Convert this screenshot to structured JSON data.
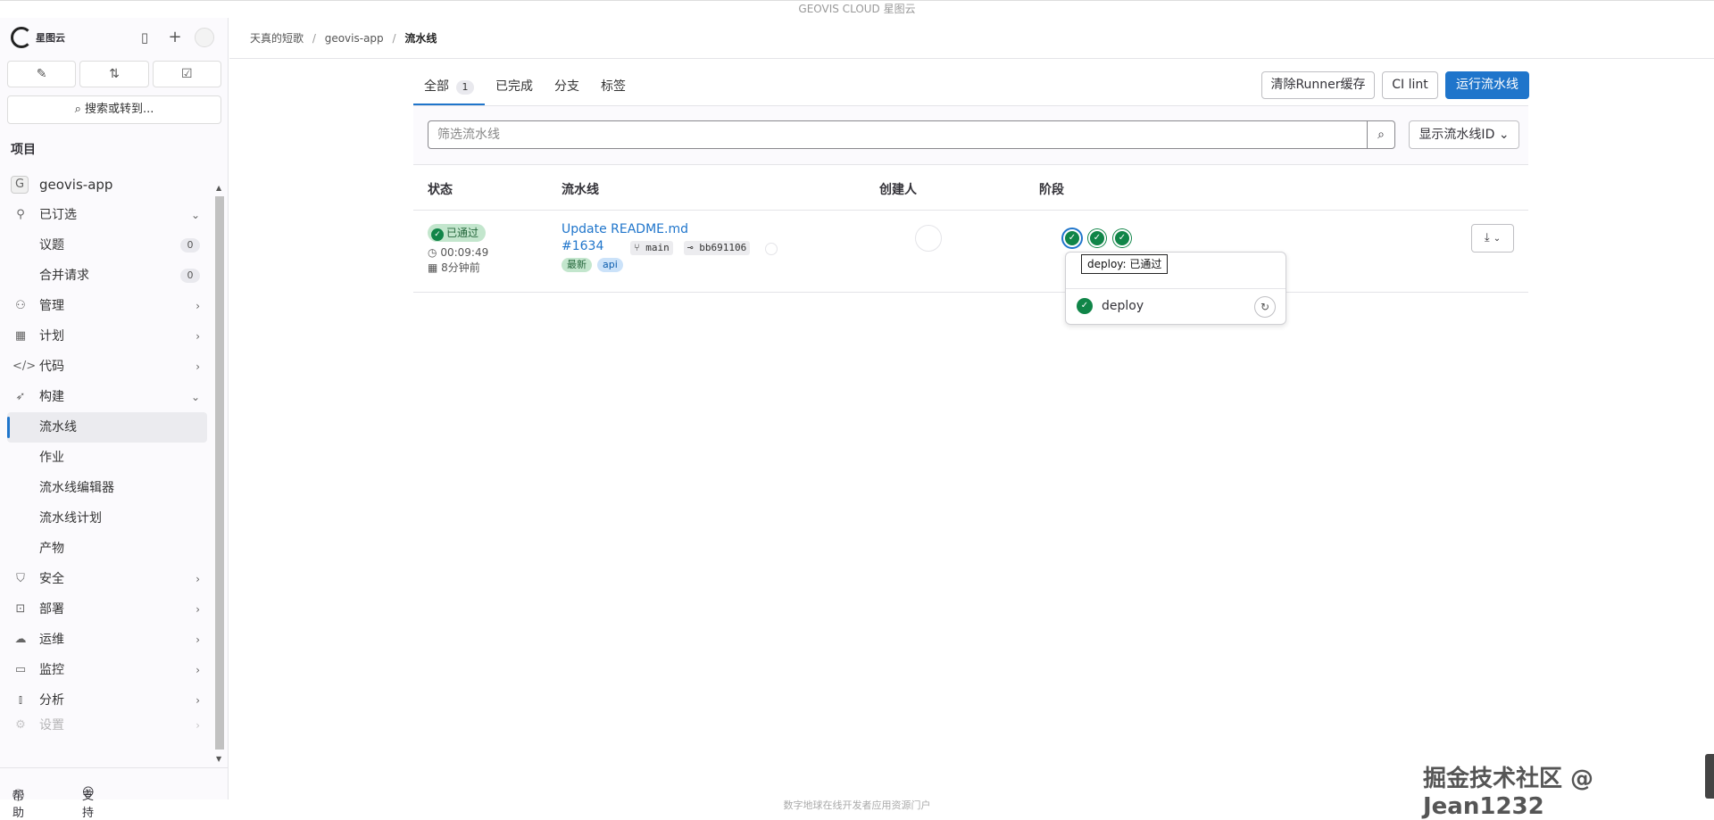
{
  "header": {
    "title": "GEOVIS CLOUD 星图云"
  },
  "sidebar": {
    "logo_text": "星图云",
    "search_label": "搜索或转到...",
    "section_title": "项目",
    "project": {
      "initial": "G",
      "name": "geovis-app"
    },
    "items": [
      {
        "label": "已订选",
        "icon": "pin-icon",
        "chevron": "⌄"
      },
      {
        "label": "议题",
        "count": "0",
        "sub": true
      },
      {
        "label": "合并请求",
        "count": "0",
        "sub": true
      },
      {
        "label": "管理",
        "icon": "users-icon",
        "chevron": "›"
      },
      {
        "label": "计划",
        "icon": "calendar-icon",
        "chevron": "›"
      },
      {
        "label": "代码",
        "icon": "code-icon",
        "chevron": "›"
      },
      {
        "label": "构建",
        "icon": "rocket-icon",
        "chevron": "⌄"
      },
      {
        "label": "流水线",
        "sub": true,
        "active": true
      },
      {
        "label": "作业",
        "sub": true
      },
      {
        "label": "流水线编辑器",
        "sub": true
      },
      {
        "label": "流水线计划",
        "sub": true
      },
      {
        "label": "产物",
        "sub": true
      },
      {
        "label": "安全",
        "icon": "shield-icon",
        "chevron": "›"
      },
      {
        "label": "部署",
        "icon": "deploy-icon",
        "chevron": "›"
      },
      {
        "label": "运维",
        "icon": "cloud-icon",
        "chevron": "›"
      },
      {
        "label": "监控",
        "icon": "monitor-icon",
        "chevron": "›"
      },
      {
        "label": "分析",
        "icon": "chart-icon",
        "chevron": "›"
      },
      {
        "label": "设置",
        "icon": "settings-icon",
        "chevron": "›"
      }
    ],
    "help_label": "帮助",
    "support_label": "支持"
  },
  "breadcrumb": {
    "items": [
      "天真的短歌",
      "geovis-app",
      "流水线"
    ]
  },
  "tabs": [
    {
      "label": "全部",
      "count": "1",
      "active": true
    },
    {
      "label": "已完成"
    },
    {
      "label": "分支"
    },
    {
      "label": "标签"
    }
  ],
  "actions": {
    "clear_cache": "清除Runner缓存",
    "ci_lint": "CI lint",
    "run_pipeline": "运行流水线"
  },
  "filter": {
    "placeholder": "筛选流水线",
    "show_id": "显示流水线ID"
  },
  "table": {
    "headers": [
      "状态",
      "流水线",
      "创建人",
      "阶段"
    ],
    "row": {
      "status": "已通过",
      "duration": "00:09:49",
      "finished": "8分钟前",
      "commit_title": "Update README.md",
      "pipeline_id": "#1634",
      "branch": "main",
      "commit_sha": "bb691106",
      "tags": [
        "最新",
        "api"
      ]
    }
  },
  "popover": {
    "tooltip": "deploy: 已通过",
    "job": "deploy"
  },
  "footer": {
    "text": "数字地球在线开发者应用资源门户"
  },
  "watermark": "掘金技术社区 @ Jean1232",
  "colors": {
    "accent": "#1f75cb",
    "success": "#108548"
  }
}
